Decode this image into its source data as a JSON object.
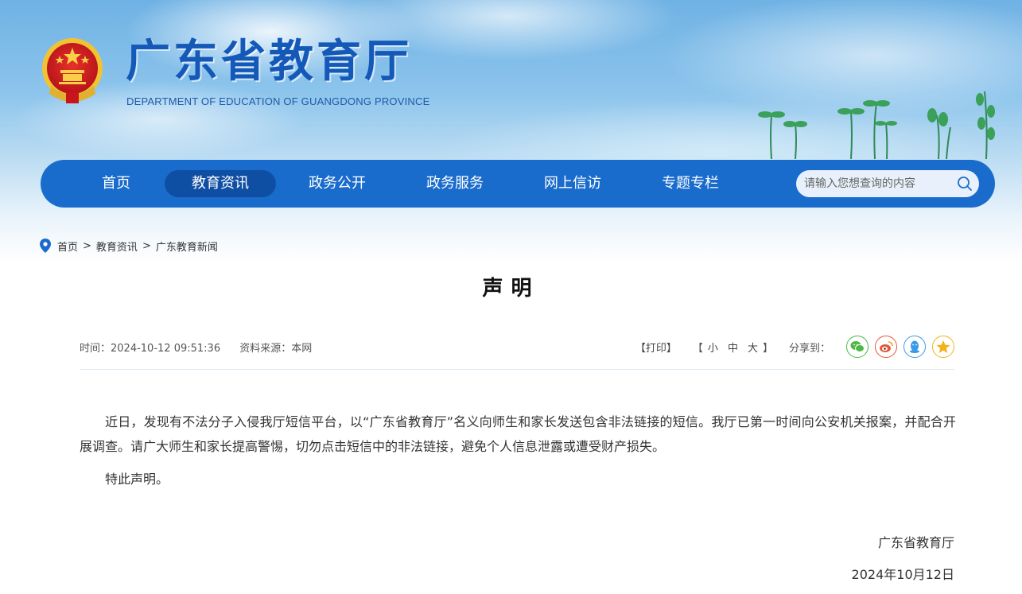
{
  "header": {
    "site_title": "广东省教育厅",
    "site_subtitle": "DEPARTMENT OF EDUCATION OF GUANGDONG PROVINCE"
  },
  "nav": {
    "items": [
      {
        "label": "首页",
        "active": false
      },
      {
        "label": "教育资讯",
        "active": true
      },
      {
        "label": "政务公开",
        "active": false
      },
      {
        "label": "政务服务",
        "active": false
      },
      {
        "label": "网上信访",
        "active": false
      },
      {
        "label": "专题专栏",
        "active": false
      }
    ],
    "search_placeholder": "请输入您想查询的内容"
  },
  "breadcrumb": {
    "items": [
      "首页",
      "教育资讯",
      "广东教育新闻"
    ],
    "separator": ">"
  },
  "article": {
    "title": "声明",
    "time_label": "时间：",
    "time_value": "2024-10-12 09:51:36",
    "source_label": "资料来源：",
    "source_value": "本网",
    "print_label": "【打印】",
    "size_open": "【",
    "size_small": "小",
    "size_medium": "中",
    "size_large": "大",
    "size_close": "】",
    "share_label": "分享到：",
    "share_icons": [
      "wechat-icon",
      "weibo-icon",
      "qq-icon",
      "qzone-icon"
    ],
    "paragraphs": [
      "近日，发现有不法分子入侵我厅短信平台，以“广东省教育厅”名义向师生和家长发送包含非法链接的短信。我厅已第一时间向公安机关报案，并配合开展调查。请广大师生和家长提高警惕，切勿点击短信中的非法链接，避免个人信息泄露或遭受财产损失。",
      "特此声明。"
    ],
    "signature_org": "广东省教育厅",
    "signature_date": "2024年10月12日"
  },
  "colors": {
    "nav_bg": "#1a6ccc",
    "nav_active": "#0f4fa3",
    "title_blue": "#1458b8",
    "wechat": "#4cb944",
    "weibo": "#e6573a",
    "qq": "#3a9be8",
    "qzone": "#f2b21c"
  }
}
